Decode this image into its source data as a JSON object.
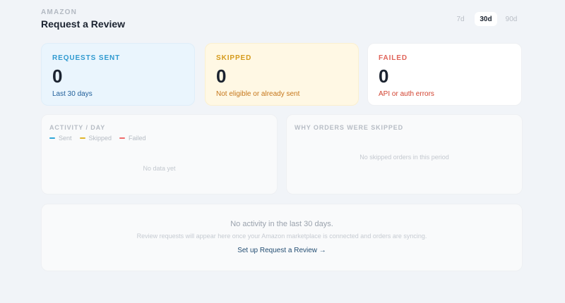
{
  "header": {
    "eyebrow": "AMAZON",
    "title": "Request a Review",
    "ranges": [
      "7d",
      "30d",
      "90d"
    ],
    "active_range": "30d"
  },
  "stats": [
    {
      "label": "REQUESTS SENT",
      "value": "0",
      "sub": "Last 30 days",
      "accent": "#2f9ad0"
    },
    {
      "label": "SKIPPED",
      "value": "0",
      "sub": "Not eligible or already sent",
      "accent": "#d59a1b"
    },
    {
      "label": "FAILED",
      "value": "0",
      "sub": "API or auth errors",
      "accent": "#e0645a"
    }
  ],
  "activity": {
    "title": "ACTIVITY / DAY",
    "legend": [
      {
        "label": "Sent",
        "color": "#2fa7d8"
      },
      {
        "label": "Skipped",
        "color": "#e0b52a"
      },
      {
        "label": "Failed",
        "color": "#ef6b6b"
      }
    ],
    "empty": "No data yet"
  },
  "skip_reasons": {
    "title": "WHY ORDERS WERE SKIPPED",
    "empty": "No skipped orders in this period"
  },
  "empty_state": {
    "headline": "No activity in the last 30 days.",
    "description": "Review requests will appear here once your Amazon marketplace is connected and orders are syncing.",
    "cta": "Set up Request a Review →"
  }
}
